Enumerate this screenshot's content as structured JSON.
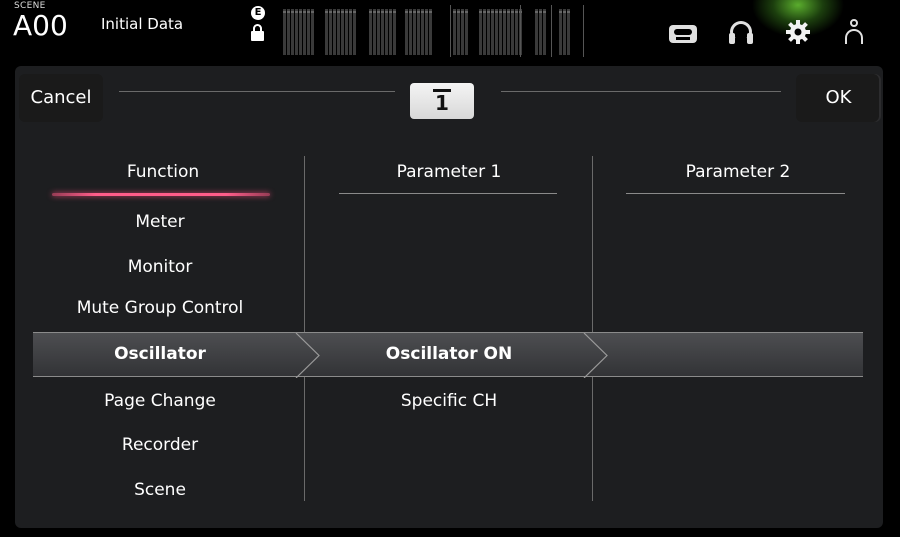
{
  "topbar": {
    "scene_caption": "SCENE",
    "scene_number": "A00",
    "scene_name": "Initial Data",
    "e_badge": "E",
    "icons": [
      "recorder-icon",
      "headphones-icon",
      "gear-icon",
      "user-icon",
      "lock-icon"
    ],
    "accent_glow": "#7be63c"
  },
  "dialog": {
    "cancel_label": "Cancel",
    "ok_label": "OK",
    "key_number": "1",
    "columns": {
      "function_header": "Function",
      "parameter1_header": "Parameter 1",
      "parameter2_header": "Parameter 2"
    },
    "function_items": [
      "Meter",
      "Monitor",
      "Mute Group Control",
      "Oscillator",
      "Page Change",
      "Recorder",
      "Scene"
    ],
    "selected_function": "Oscillator",
    "parameter1_items": [
      "Oscillator ON",
      "Specific CH"
    ],
    "selected_parameter1": "Oscillator ON",
    "accent_color": "#ff5d8a"
  }
}
